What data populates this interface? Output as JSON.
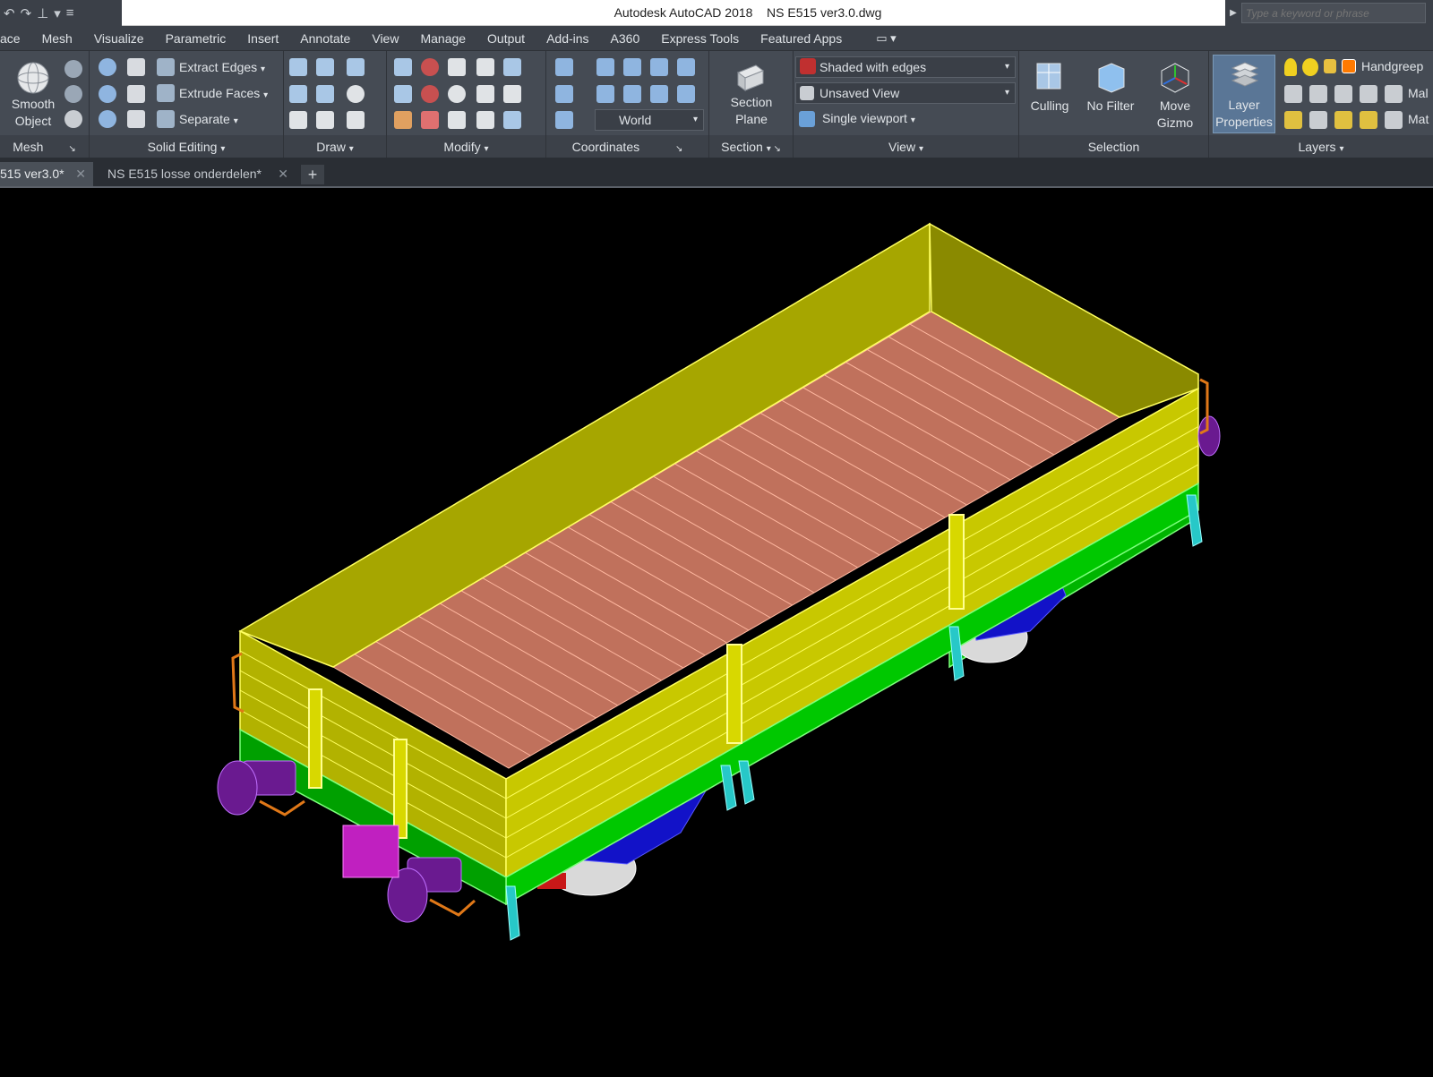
{
  "title_bar": {
    "app": "Autodesk AutoCAD 2018",
    "file": "NS E515 ver3.0.dwg",
    "search_placeholder": "Type a keyword or phrase"
  },
  "ribbon_tabs": [
    "ace",
    "Mesh",
    "Visualize",
    "Parametric",
    "Insert",
    "Annotate",
    "View",
    "Manage",
    "Output",
    "Add-ins",
    "A360",
    "Express Tools",
    "Featured Apps"
  ],
  "panels": {
    "mesh": {
      "title": "Mesh",
      "smooth_object": "Smooth\nObject"
    },
    "solid_editing": {
      "title": "Solid Editing",
      "extract_edges": "Extract Edges",
      "extrude_faces": "Extrude Faces",
      "separate": "Separate"
    },
    "draw": {
      "title": "Draw"
    },
    "modify": {
      "title": "Modify"
    },
    "coordinates": {
      "title": "Coordinates",
      "ucs_value": "World"
    },
    "section": {
      "title": "Section",
      "section_plane": "Section\nPlane"
    },
    "view": {
      "title": "View",
      "visual_style": "Shaded with edges",
      "named_view": "Unsaved View",
      "viewport": "Single viewport"
    },
    "selection": {
      "title": "Selection",
      "culling": "Culling",
      "no_filter": "No Filter",
      "move_gizmo": "Move\nGizmo"
    },
    "layers": {
      "title": "Layers",
      "layer_properties": "Layer\nProperties",
      "layer_name": "Handgreep",
      "row2": "Mal",
      "row3": "Mat"
    }
  },
  "file_tabs": [
    {
      "label": "515 ver3.0*",
      "active": true
    },
    {
      "label": "NS E515 losse onderdelen*",
      "active": false
    }
  ],
  "colors": {
    "body_yellow": "#d9d900",
    "floor": "#c0715c",
    "frame_green": "#00c800",
    "bogie_blue": "#1010c0",
    "buffer_purple": "#6a1a90",
    "step_cyan": "#27c8c8",
    "handle_orange": "#e07818",
    "wheel_red": "#c01818",
    "plate_magenta": "#c020c0"
  }
}
